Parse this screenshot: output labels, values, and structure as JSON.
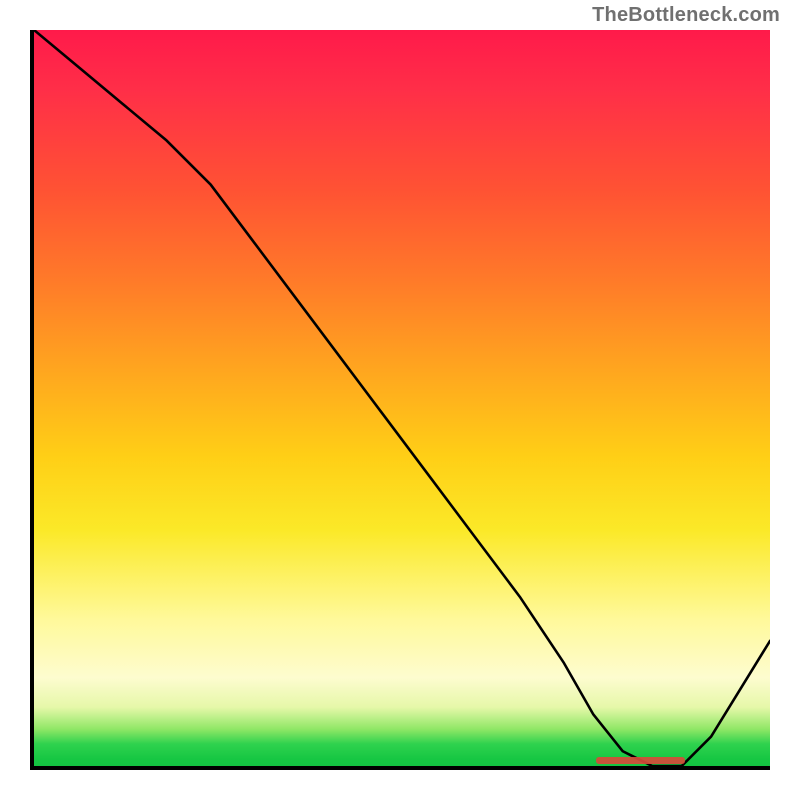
{
  "watermark": "TheBottleneck.com",
  "chart_data": {
    "type": "line",
    "title": "",
    "xlabel": "",
    "ylabel": "",
    "xlim": [
      0,
      100
    ],
    "ylim": [
      0,
      100
    ],
    "x": [
      0,
      6,
      12,
      18,
      24,
      30,
      36,
      42,
      48,
      54,
      60,
      66,
      72,
      76,
      80,
      84,
      88,
      92,
      100
    ],
    "values": [
      100,
      95,
      90,
      85,
      79,
      71,
      63,
      55,
      47,
      39,
      31,
      23,
      14,
      7,
      2,
      0,
      0,
      4,
      17
    ],
    "optimum_band": {
      "x_start": 76,
      "x_end": 88,
      "color": "#d64a3a"
    },
    "gradient_stops": [
      {
        "pct": 0,
        "color": "#ff1a4a"
      },
      {
        "pct": 22,
        "color": "#ff5333"
      },
      {
        "pct": 46,
        "color": "#ffa51f"
      },
      {
        "pct": 68,
        "color": "#fbe928"
      },
      {
        "pct": 88,
        "color": "#fdfccf"
      },
      {
        "pct": 97,
        "color": "#2fd24e"
      },
      {
        "pct": 100,
        "color": "#13c441"
      }
    ]
  }
}
